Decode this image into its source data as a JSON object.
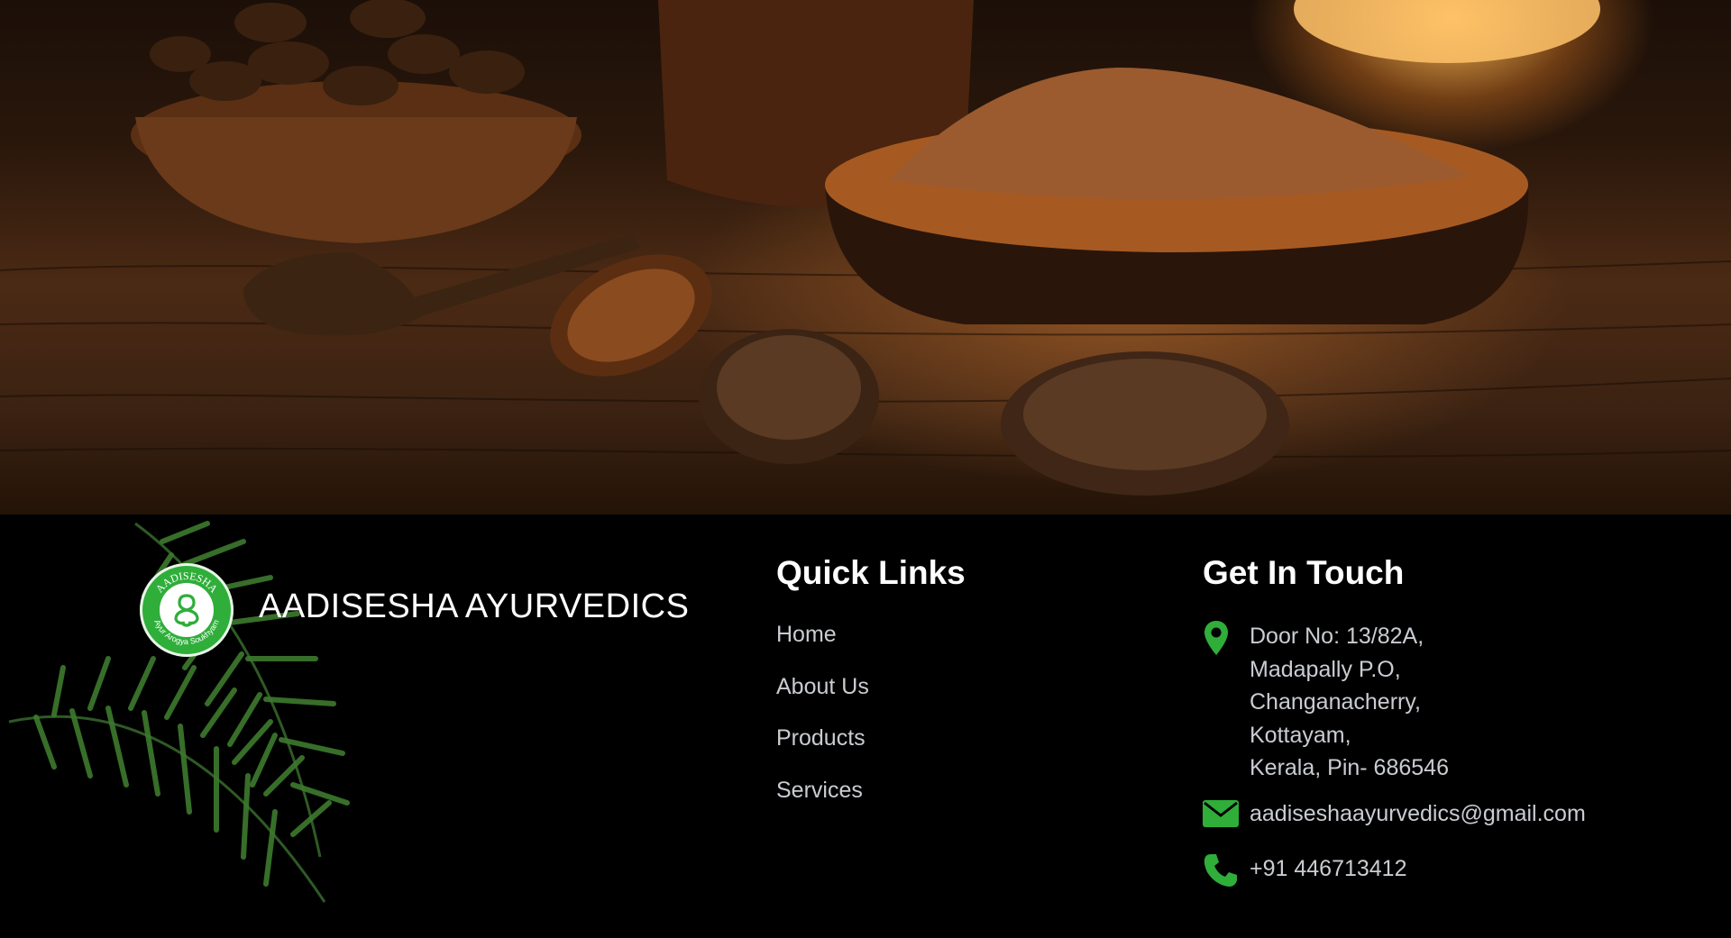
{
  "hero": {
    "image": "ayurvedic-ingredients-photo"
  },
  "brand": {
    "logo_top_text": "AADISESHA",
    "logo_bottom_text": "Ayur Arogya Soukhyam",
    "name": "AADISESHA AYURVEDICS"
  },
  "quick_links": {
    "title": "Quick Links",
    "items": [
      {
        "label": "Home"
      },
      {
        "label": "About Us"
      },
      {
        "label": "Products"
      },
      {
        "label": "Services"
      }
    ]
  },
  "contact": {
    "title": "Get In Touch",
    "address_lines": [
      "Door No: 13/82A,",
      "Madapally P.O,",
      "Changanacherry,",
      "Kottayam,",
      "Kerala, Pin- 686546"
    ],
    "email": "aadiseshaayurvedics@gmail.com",
    "phone": "+91 446713412",
    "icon_names": [
      "location-pin-icon",
      "email-icon",
      "phone-icon"
    ],
    "icon_color": "#2fae3a"
  },
  "colors": {
    "background": "#000000",
    "heading": "#ffffff",
    "link": "#c9ccd1",
    "accent": "#2fae3a"
  }
}
